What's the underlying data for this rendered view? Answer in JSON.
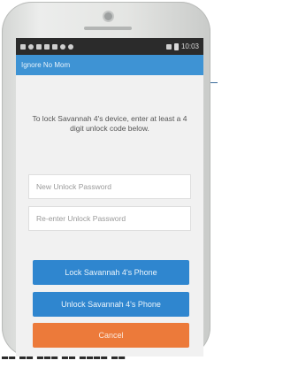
{
  "status_bar": {
    "time": "10:03"
  },
  "app_bar": {
    "title": "Ignore No Mom"
  },
  "instructions": "To lock Savannah 4's device, enter at least a 4 digit unlock code below.",
  "fields": {
    "new_password": {
      "placeholder": "New Unlock Password"
    },
    "reenter_password": {
      "placeholder": "Re-enter Unlock Password"
    }
  },
  "buttons": {
    "lock": "Lock Savannah 4's Phone",
    "unlock": "Unlock Savannah 4's Phone",
    "cancel": "Cancel"
  },
  "colors": {
    "app_bar": "#3e93d4",
    "button_blue": "#2f86cf",
    "button_cancel": "#ec7a3a"
  }
}
